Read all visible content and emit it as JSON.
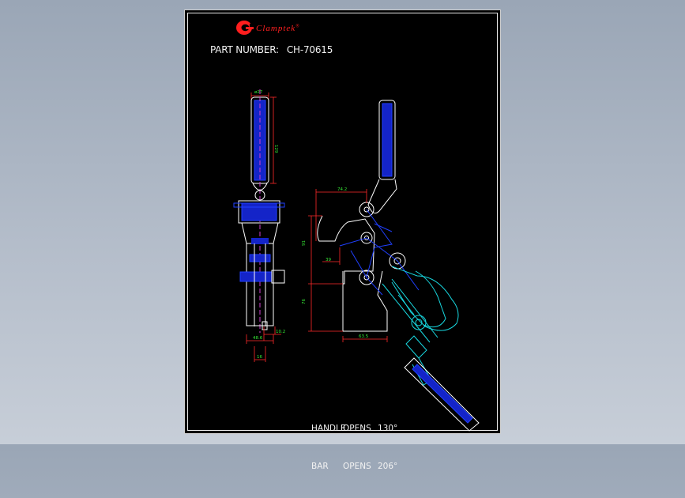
{
  "logo": {
    "mark": "C",
    "name": "Clamptek",
    "reg": "®",
    "color": "#ff2020"
  },
  "part_number": {
    "label": "PART NUMBER:",
    "value": "CH-70615"
  },
  "dimensions": {
    "front_width_top": "ø27",
    "front_handle_length": "129",
    "front_base_width": "48.6",
    "front_slot": "10.2",
    "front_bottom": "16",
    "side_top_width": "74.2",
    "side_height_upper": "91",
    "side_offset": "39",
    "side_height_lower": "76",
    "side_base_width": "63.5"
  },
  "notes": [
    {
      "label": "HANDLE",
      "word": "OPENS",
      "value": "130°"
    },
    {
      "label": "BAR",
      "word": "OPENS",
      "value": "206°"
    }
  ],
  "colors": {
    "background": "#000000",
    "outline": "#ffffff",
    "dimension": "#ff2a2a",
    "dimension_text": "#35e835",
    "detail": "#2030ff",
    "open_position": "#18d8e0",
    "center_line": "#d040d0"
  }
}
